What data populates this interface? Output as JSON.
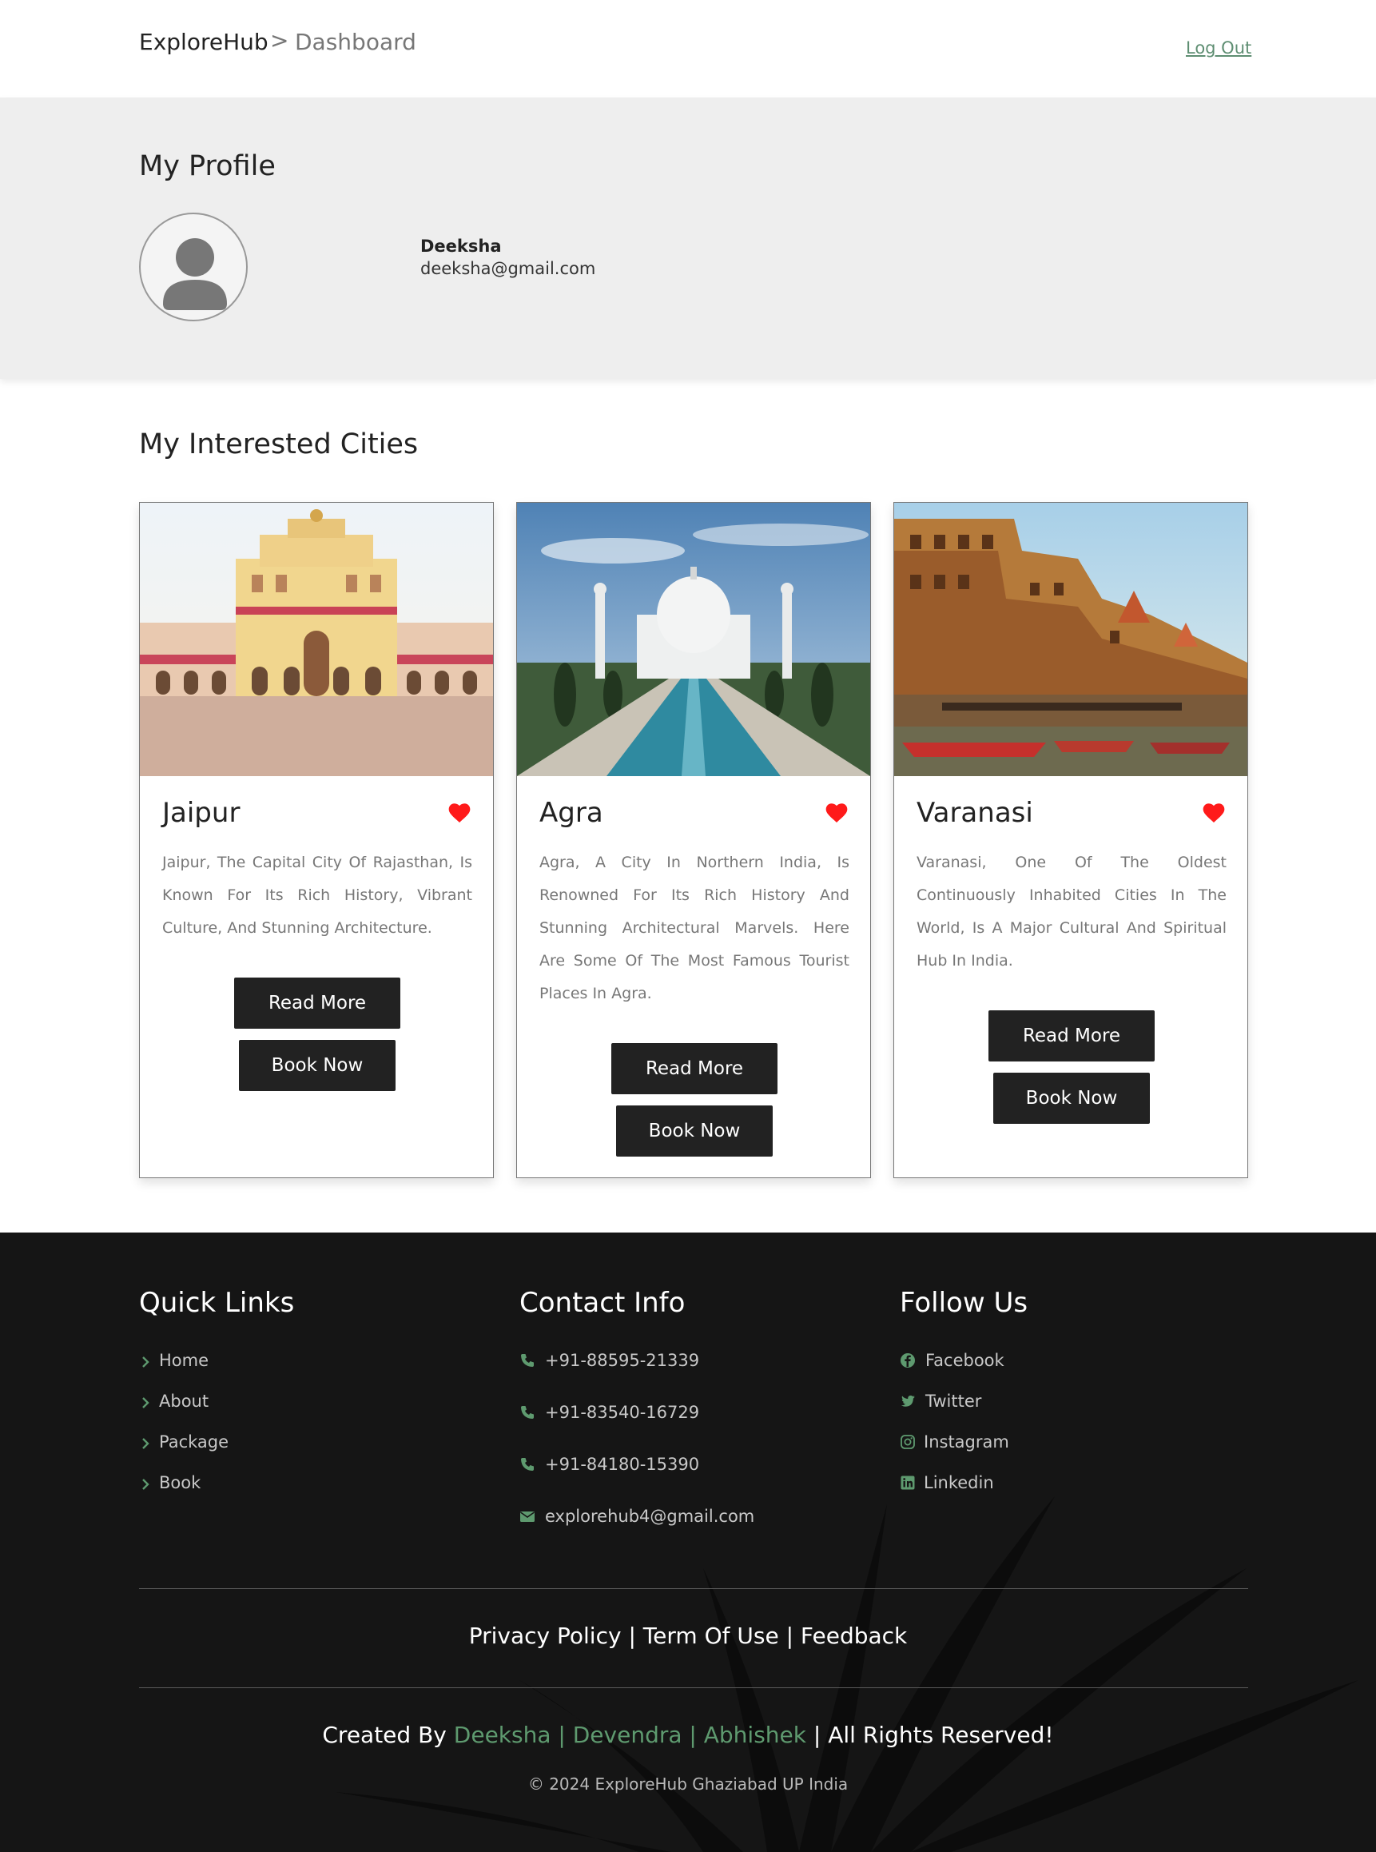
{
  "header": {
    "brand": "ExploreHub",
    "separator": ">",
    "page": "Dashboard",
    "logout": "Log Out"
  },
  "profile": {
    "title": "My Profile",
    "name": "Deeksha",
    "email": "deeksha@gmail.com"
  },
  "cities": {
    "title": "My Interested Cities",
    "cards": [
      {
        "name": "Jaipur",
        "description": "Jaipur, The Capital City Of Rajasthan, Is Known For Its Rich History, Vibrant Culture, And Stunning Architecture.",
        "read_more": "Read More",
        "book_now": "Book Now"
      },
      {
        "name": "Agra",
        "description": "Agra, A City In Northern India, Is Renowned For Its Rich History And Stunning Architectural Marvels. Here Are Some Of The Most Famous Tourist Places In Agra.",
        "read_more": "Read More",
        "book_now": "Book Now"
      },
      {
        "name": "Varanasi",
        "description": "Varanasi, One Of The Oldest Continuously Inhabited Cities In The World, Is A Major Cultural And Spiritual Hub In India.",
        "read_more": "Read More",
        "book_now": "Book Now"
      }
    ]
  },
  "footer": {
    "quick_links": {
      "title": "Quick Links",
      "items": [
        "Home",
        "About",
        "Package",
        "Book"
      ]
    },
    "contact": {
      "title": "Contact Info",
      "phones": [
        "+91-88595-21339",
        "+91-83540-16729",
        "+91-84180-15390"
      ],
      "email": "explorehub4@gmail.com"
    },
    "follow": {
      "title": "Follow Us",
      "items": [
        "Facebook",
        "Twitter",
        "Instagram",
        "Linkedin"
      ]
    },
    "policy": {
      "privacy": "Privacy Policy",
      "sep": "|",
      "terms": "Term Of Use",
      "feedback": "Feedback"
    },
    "credits": {
      "prefix": "Created By",
      "authors": "Deeksha | Devendra | Abhishek",
      "suffix": "| All Rights Reserved!"
    },
    "copyright": "© 2024 ExploreHub Ghaziabad UP India"
  },
  "colors": {
    "accent_green": "#5e9a6f",
    "heart_red": "#ff1a1a",
    "button_dark": "#222222",
    "footer_bg": "#151515"
  }
}
